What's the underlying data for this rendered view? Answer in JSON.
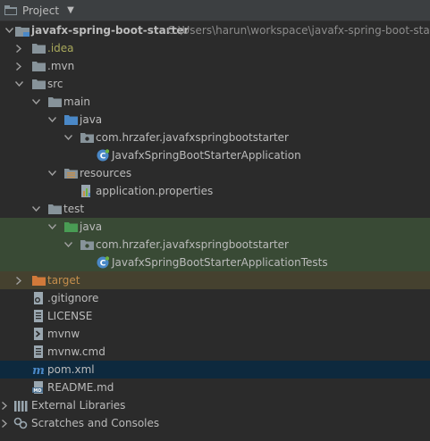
{
  "header": {
    "title": "Project",
    "caret": "▼"
  },
  "tree": {
    "root_label": "javafx-spring-boot-starter",
    "root_path": "C:\\Users\\harun\\workspace\\javafx-spring-boot-starter",
    "idea": ".idea",
    "mvn": ".mvn",
    "src": "src",
    "main": "main",
    "main_java": "java",
    "main_pkg": "com.hrzafer.javafxspringbootstarter",
    "main_class": "JavafxSpringBootStarterApplication",
    "resources": "resources",
    "app_props": "application.properties",
    "test": "test",
    "test_java": "java",
    "test_pkg": "com.hrzafer.javafxspringbootstarter",
    "test_class": "JavafxSpringBootStarterApplicationTests",
    "target": "target",
    "gitignore": ".gitignore",
    "license": "LICENSE",
    "mvnw": "mvnw",
    "mvnw_cmd": "mvnw.cmd",
    "pom": "pom.xml",
    "readme": "README.md",
    "ext_libs": "External Libraries",
    "scratches": "Scratches and Consoles"
  },
  "colors": {
    "background": "#2b2b2b",
    "header": "#3c3f41",
    "test_highlight": "#394a35",
    "excluded_highlight": "#45412f",
    "selection": "#0d293e",
    "folder": "#87939a",
    "source_folder": "#4a88c7",
    "test_folder": "#499c54",
    "excluded_folder": "#d1793a"
  }
}
